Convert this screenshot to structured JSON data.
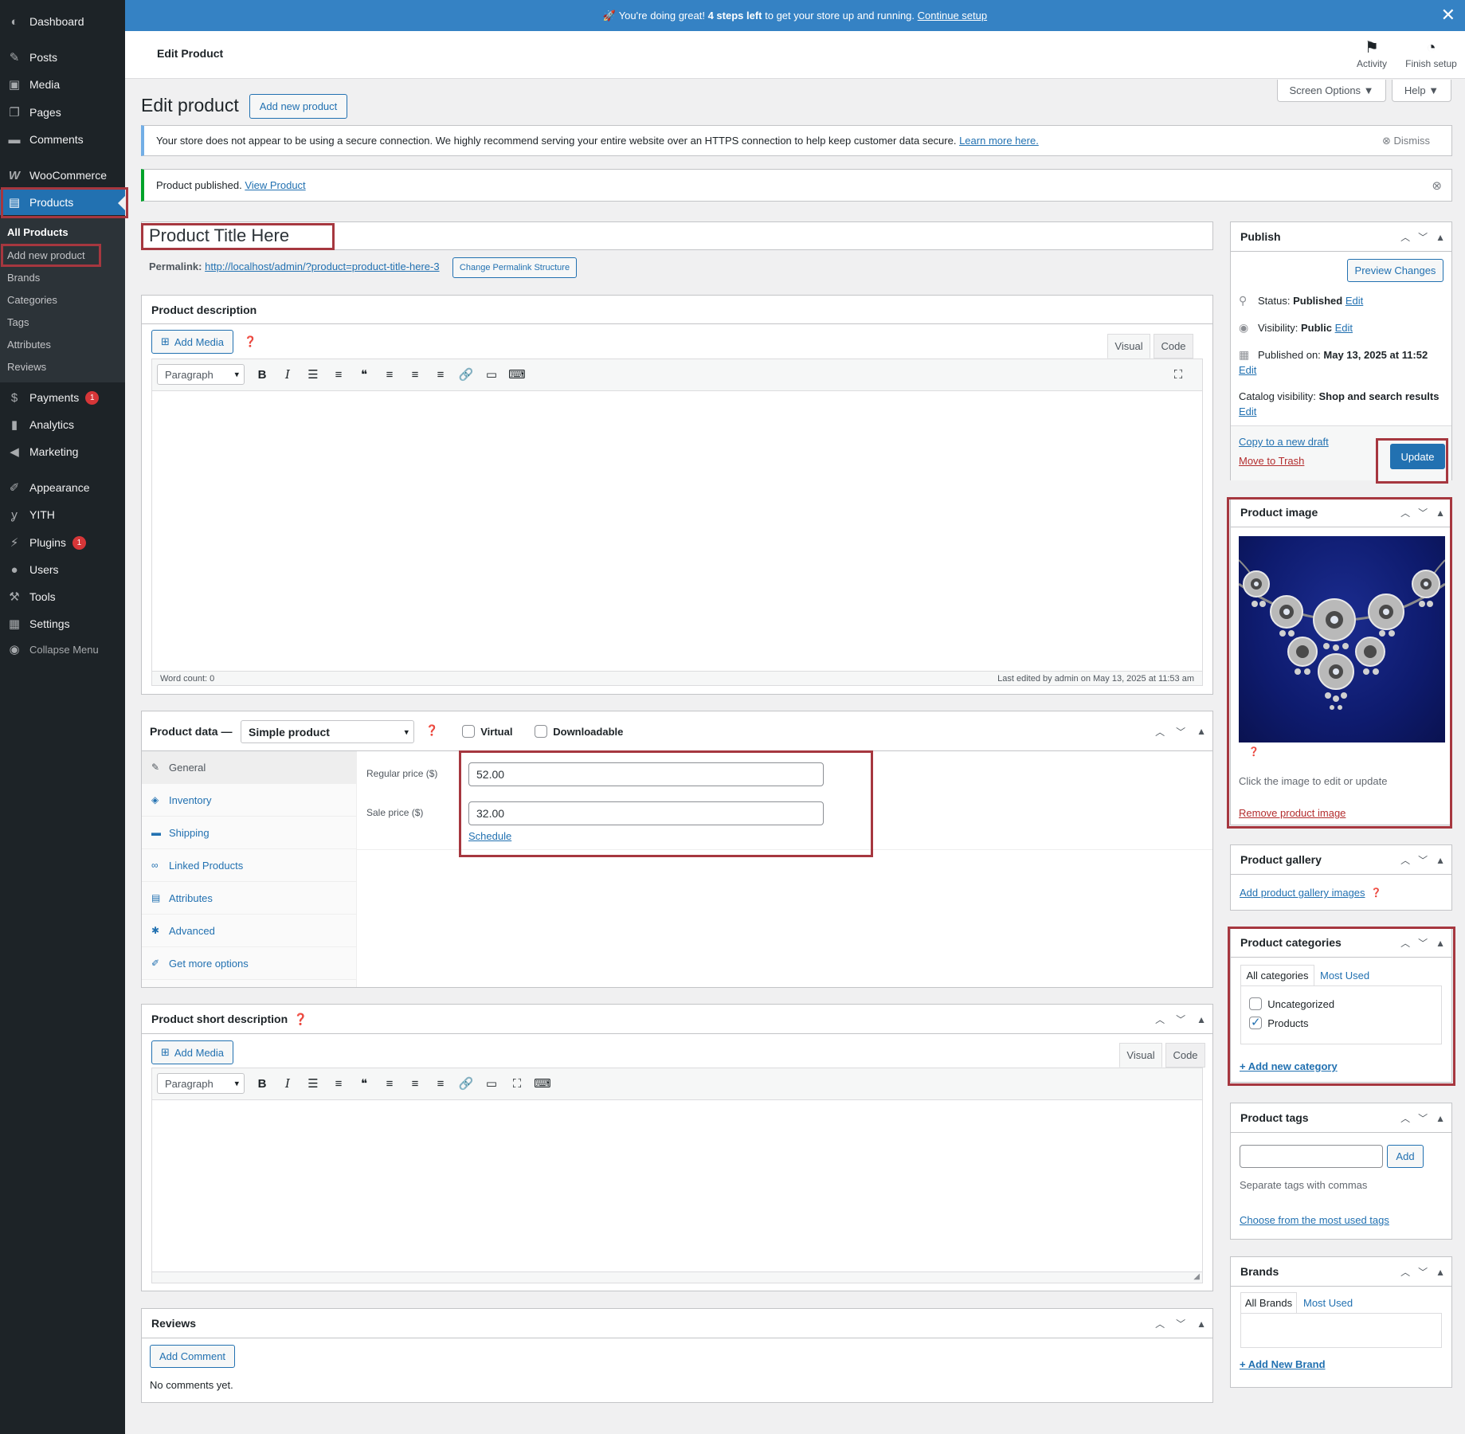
{
  "sidebar": {
    "items": [
      {
        "label": "Dashboard",
        "icon": "dashboard-icon"
      },
      {
        "label": "Posts",
        "icon": "pin-icon"
      },
      {
        "label": "Media",
        "icon": "media-icon"
      },
      {
        "label": "Pages",
        "icon": "pages-icon"
      },
      {
        "label": "Comments",
        "icon": "comments-icon"
      },
      {
        "label": "WooCommerce",
        "icon": "woocommerce-icon"
      },
      {
        "label": "Products",
        "icon": "archive-icon"
      },
      {
        "label": "Payments",
        "icon": "dollar-icon",
        "badge": "1"
      },
      {
        "label": "Analytics",
        "icon": "bar-chart-icon"
      },
      {
        "label": "Marketing",
        "icon": "megaphone-icon"
      },
      {
        "label": "Appearance",
        "icon": "brush-icon"
      },
      {
        "label": "YITH",
        "icon": "yith-icon"
      },
      {
        "label": "Plugins",
        "icon": "plugin-icon",
        "badge": "1"
      },
      {
        "label": "Users",
        "icon": "user-icon"
      },
      {
        "label": "Tools",
        "icon": "wrench-icon"
      },
      {
        "label": "Settings",
        "icon": "settings-icon"
      },
      {
        "label": "Collapse Menu",
        "icon": "collapse-icon"
      }
    ],
    "submenu": [
      "All Products",
      "Add new product",
      "Brands",
      "Categories",
      "Tags",
      "Attributes",
      "Reviews"
    ]
  },
  "banner": {
    "emoji": "🚀",
    "pre": "You're doing great!",
    "bold": "4 steps left",
    "post": "to get your store up and running.",
    "link": "Continue setup"
  },
  "header": {
    "title": "Edit Product",
    "activity": "Activity",
    "finish": "Finish setup"
  },
  "screen_options": "Screen Options ▼",
  "help": "Help ▼",
  "page": {
    "title": "Edit product",
    "add_new": "Add new product"
  },
  "notice_ssl": {
    "text": "Your store does not appear to be using a secure connection. We highly recommend serving your entire website over an HTTPS connection to help keep customer data secure.",
    "link": "Learn more here.",
    "dismiss": "Dismiss"
  },
  "notice_pub": {
    "text": "Product published.",
    "link": "View Product"
  },
  "product_title": "Product Title Here",
  "permalink": {
    "label": "Permalink:",
    "url": "http://localhost/admin/?product=product-title-here-3",
    "button": "Change Permalink Structure"
  },
  "description": {
    "heading": "Product description",
    "add_media": "Add Media",
    "visual": "Visual",
    "code": "Code",
    "format": "Paragraph",
    "word_count": "Word count: 0",
    "last_edited": "Last edited by admin on May 13, 2025 at 11:53 am"
  },
  "product_data": {
    "heading": "Product data —",
    "type": "Simple product",
    "virtual": "Virtual",
    "downloadable": "Downloadable",
    "tabs": [
      "General",
      "Inventory",
      "Shipping",
      "Linked Products",
      "Attributes",
      "Advanced",
      "Get more options"
    ],
    "regular_label": "Regular price ($)",
    "regular_value": "52.00",
    "sale_label": "Sale price ($)",
    "sale_value": "32.00",
    "schedule": "Schedule"
  },
  "short_desc": {
    "heading": "Product short description",
    "add_media": "Add Media",
    "visual": "Visual",
    "code": "Code",
    "format": "Paragraph"
  },
  "reviews": {
    "heading": "Reviews",
    "add_comment": "Add Comment",
    "empty": "No comments yet."
  },
  "publish": {
    "heading": "Publish",
    "preview": "Preview Changes",
    "status_label": "Status:",
    "status_value": "Published",
    "edit": "Edit",
    "visibility_label": "Visibility:",
    "visibility_value": "Public",
    "published_label": "Published on:",
    "published_value": "May 13, 2025 at 11:52",
    "catalog_label": "Catalog visibility:",
    "catalog_value": "Shop and search results",
    "copy": "Copy to a new draft",
    "trash": "Move to Trash",
    "update": "Update"
  },
  "product_image": {
    "heading": "Product image",
    "hint": "Click the image to edit or update",
    "remove": "Remove product image"
  },
  "gallery": {
    "heading": "Product gallery",
    "link": "Add product gallery images"
  },
  "categories": {
    "heading": "Product categories",
    "tab_all": "All categories",
    "tab_used": "Most Used",
    "items": [
      {
        "label": "Uncategorized",
        "checked": false
      },
      {
        "label": "Products",
        "checked": true
      }
    ],
    "add": "+ Add new category"
  },
  "tags": {
    "heading": "Product tags",
    "add": "Add",
    "hint": "Separate tags with commas",
    "choose": "Choose from the most used tags"
  },
  "brands": {
    "heading": "Brands",
    "tab_all": "All Brands",
    "tab_used": "Most Used",
    "add": "+ Add New Brand"
  },
  "colors": {
    "sidebar": "#1d2327",
    "accent": "#2271b1",
    "highlight": "#a6373f",
    "banner": "#3582c4"
  }
}
